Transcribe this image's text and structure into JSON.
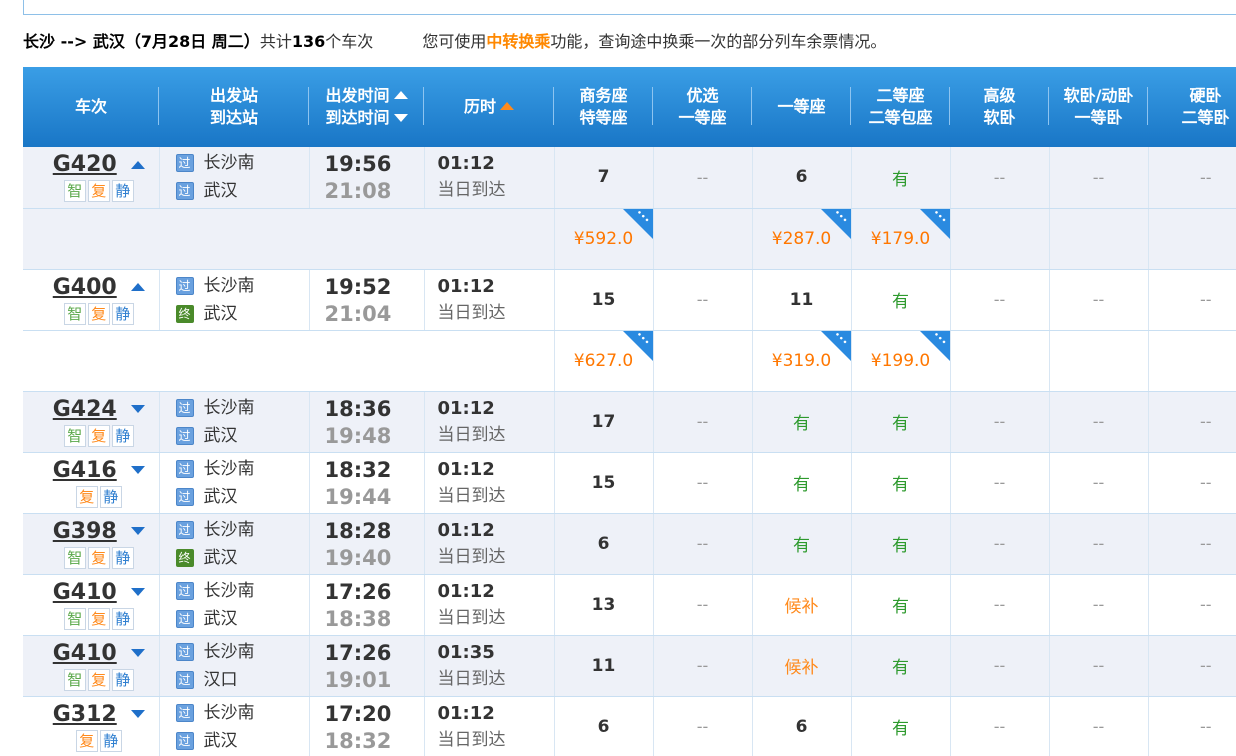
{
  "summary": {
    "route": "长沙 --> 武汉（7月28日  周二）",
    "total_prefix": "共计",
    "total_count": "136",
    "total_suffix": "个车次",
    "hint_pre": "您可使用",
    "hint_link": "中转换乘",
    "hint_post": "功能，查询途中换乘一次的部分列车余票情况。"
  },
  "colors": {
    "header_blue": "#1976c6",
    "accent_orange": "#ff8a1c",
    "available_green": "#2d9a2d",
    "price_orange": "#ff7700"
  },
  "headers": {
    "train": "车次",
    "station_from": "出发站",
    "station_to": "到达站",
    "time_dep": "出发时间",
    "time_arr": "到达时间",
    "duration": "历时",
    "business_1": "商务座",
    "business_2": "特等座",
    "premium_1": "优选",
    "premium_2": "一等座",
    "first": "一等座",
    "second_1": "二等座",
    "second_2": "二等包座",
    "soft_premium_1": "高级",
    "soft_premium_2": "软卧",
    "soft_1": "软卧/动卧",
    "soft_2": "一等卧",
    "hard_1": "硬卧",
    "hard_2": "二等卧"
  },
  "tag_labels": {
    "zhi": "智",
    "fu": "复",
    "jing": "静"
  },
  "badge_labels": {
    "guo": "过",
    "zhong": "终"
  },
  "trains": [
    {
      "code": "G420",
      "dir": "up",
      "tags": [
        "zhi",
        "fu",
        "jing"
      ],
      "from": "长沙南",
      "to": "武汉",
      "to_badge": "guo",
      "dep": "19:56",
      "arr": "21:08",
      "dur": "01:12",
      "same_day": "当日到达",
      "business": "7",
      "premium": "--",
      "first": "6",
      "second": "有",
      "soft_premium": "--",
      "soft": "--",
      "hard": "--",
      "prices": {
        "business": "¥592.0",
        "first": "¥287.0",
        "second": "¥179.0"
      }
    },
    {
      "code": "G400",
      "dir": "up",
      "tags": [
        "zhi",
        "fu",
        "jing"
      ],
      "from": "长沙南",
      "to": "武汉",
      "to_badge": "zhong",
      "dep": "19:52",
      "arr": "21:04",
      "dur": "01:12",
      "same_day": "当日到达",
      "business": "15",
      "premium": "--",
      "first": "11",
      "second": "有",
      "soft_premium": "--",
      "soft": "--",
      "hard": "--",
      "prices": {
        "business": "¥627.0",
        "first": "¥319.0",
        "second": "¥199.0"
      }
    },
    {
      "code": "G424",
      "dir": "down",
      "tags": [
        "zhi",
        "fu",
        "jing"
      ],
      "from": "长沙南",
      "to": "武汉",
      "to_badge": "guo",
      "dep": "18:36",
      "arr": "19:48",
      "dur": "01:12",
      "same_day": "当日到达",
      "business": "17",
      "premium": "--",
      "first": "有",
      "second": "有",
      "soft_premium": "--",
      "soft": "--",
      "hard": "--"
    },
    {
      "code": "G416",
      "dir": "down",
      "tags": [
        "fu",
        "jing"
      ],
      "from": "长沙南",
      "to": "武汉",
      "to_badge": "guo",
      "dep": "18:32",
      "arr": "19:44",
      "dur": "01:12",
      "same_day": "当日到达",
      "business": "15",
      "premium": "--",
      "first": "有",
      "second": "有",
      "soft_premium": "--",
      "soft": "--",
      "hard": "--"
    },
    {
      "code": "G398",
      "dir": "down",
      "tags": [
        "zhi",
        "fu",
        "jing"
      ],
      "from": "长沙南",
      "to": "武汉",
      "to_badge": "zhong",
      "dep": "18:28",
      "arr": "19:40",
      "dur": "01:12",
      "same_day": "当日到达",
      "business": "6",
      "premium": "--",
      "first": "有",
      "second": "有",
      "soft_premium": "--",
      "soft": "--",
      "hard": "--"
    },
    {
      "code": "G410",
      "dir": "down",
      "tags": [
        "zhi",
        "fu",
        "jing"
      ],
      "from": "长沙南",
      "to": "武汉",
      "to_badge": "guo",
      "dep": "17:26",
      "arr": "18:38",
      "dur": "01:12",
      "same_day": "当日到达",
      "business": "13",
      "premium": "--",
      "first": "候补",
      "second": "有",
      "soft_premium": "--",
      "soft": "--",
      "hard": "--"
    },
    {
      "code": "G410",
      "dir": "down",
      "tags": [
        "zhi",
        "fu",
        "jing"
      ],
      "from": "长沙南",
      "to": "汉口",
      "to_badge": "guo",
      "dep": "17:26",
      "arr": "19:01",
      "dur": "01:35",
      "same_day": "当日到达",
      "business": "11",
      "premium": "--",
      "first": "候补",
      "second": "有",
      "soft_premium": "--",
      "soft": "--",
      "hard": "--"
    },
    {
      "code": "G312",
      "dir": "down",
      "tags": [
        "fu",
        "jing"
      ],
      "from": "长沙南",
      "to": "武汉",
      "to_badge": "guo",
      "dep": "17:20",
      "arr": "18:32",
      "dur": "01:12",
      "same_day": "当日到达",
      "business": "6",
      "premium": "--",
      "first": "6",
      "second": "有",
      "soft_premium": "--",
      "soft": "--",
      "hard": "--"
    }
  ]
}
